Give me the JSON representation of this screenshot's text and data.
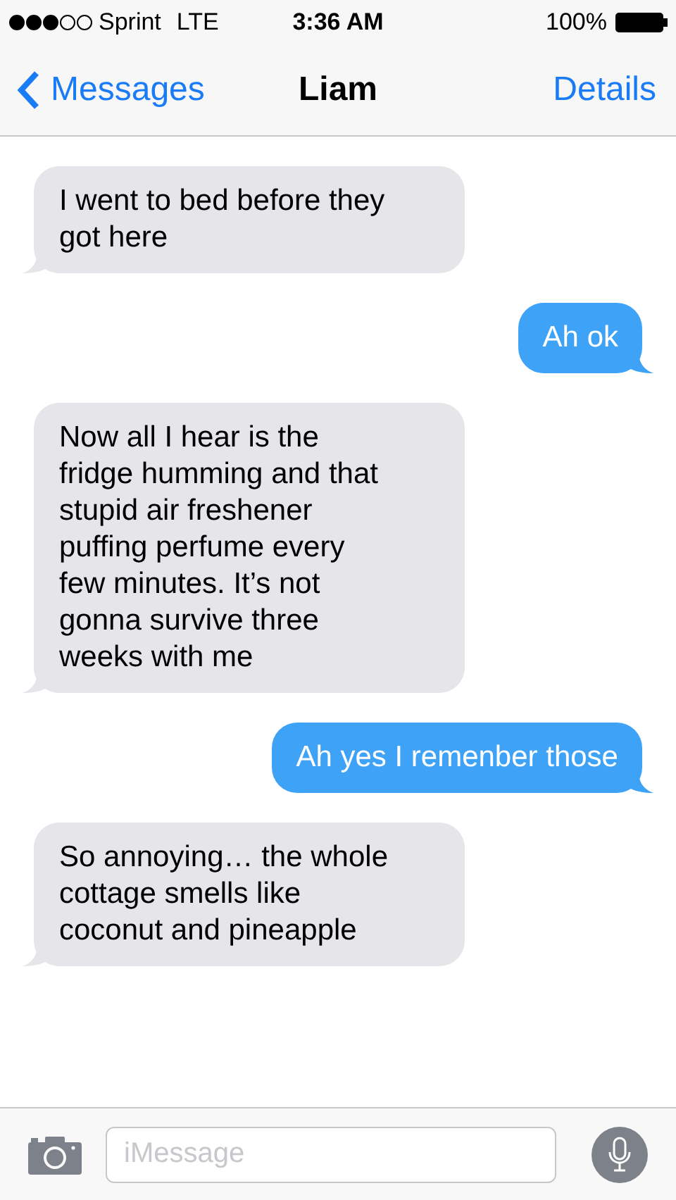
{
  "status_bar": {
    "carrier": "Sprint",
    "network": "LTE",
    "time": "3:36 AM",
    "battery": "100%"
  },
  "nav": {
    "back": "Messages",
    "title": "Liam",
    "action": "Details"
  },
  "messages": [
    {
      "lines": [
        "I went to bed before they",
        "got here"
      ],
      "kind": "received"
    },
    {
      "lines": [
        "Ah ok"
      ],
      "kind": "sent"
    },
    {
      "lines": [
        "Now all I hear is the",
        "fridge humming and that",
        "stupid air freshener",
        "puffing perfume every",
        "few minutes. It’s not",
        "gonna survive three",
        "weeks with me"
      ],
      "kind": "received"
    },
    {
      "lines": [
        "Ah yes I remenber those"
      ],
      "kind": "sent"
    },
    {
      "lines": [
        "So annoying… the whole",
        "cottage smells like",
        "coconut and pineapple"
      ],
      "kind": "received"
    }
  ],
  "compose": {
    "placeholder": "iMessage"
  }
}
